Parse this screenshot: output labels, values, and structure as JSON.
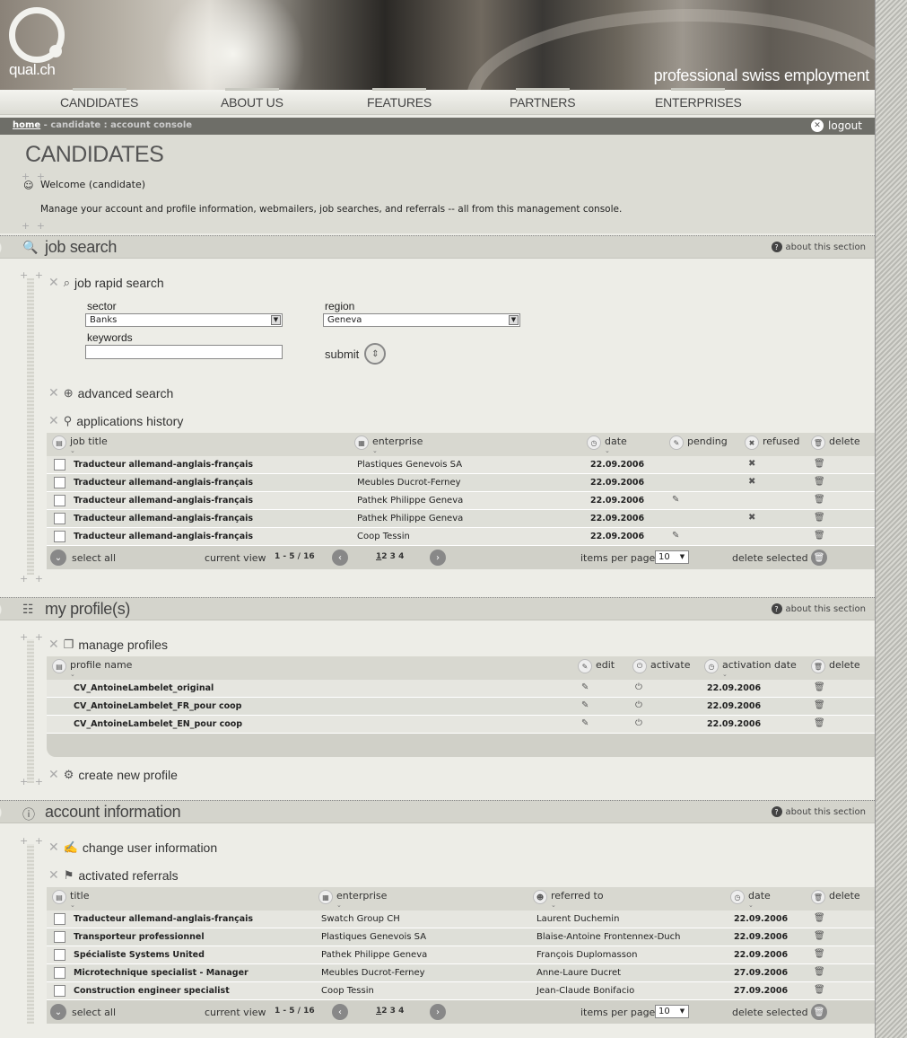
{
  "site": {
    "logo_text": "qual.ch",
    "tagline": "professional swiss employment"
  },
  "nav": [
    "CANDIDATES",
    "ABOUT US",
    "FEATURES",
    "PARTNERS",
    "ENTERPRISES"
  ],
  "breadcrumb": {
    "home": "home",
    "rest": " - candidate : account console",
    "logout": "logout"
  },
  "intro": {
    "title": "CANDIDATES",
    "welcome": "Welcome (candidate)",
    "description": "Manage your account and profile information, webmailers, job searches, and referrals -- all from this management console."
  },
  "about_label": "about this section",
  "job_search": {
    "title": "job search",
    "rapid_title": "job rapid search",
    "sector_label": "sector",
    "sector_value": "Banks",
    "region_label": "region",
    "region_value": "Geneva",
    "keywords_label": "keywords",
    "keywords_value": "",
    "submit_label": "submit",
    "advanced_title": "advanced search",
    "history_title": "applications history",
    "columns": [
      "job title",
      "enterprise",
      "date",
      "pending",
      "refused",
      "delete"
    ],
    "rows": [
      {
        "title": "Traducteur allemand-anglais-français",
        "enterprise": "Plastiques Genevois SA",
        "date": "22.09.2006",
        "pending": false,
        "refused": true
      },
      {
        "title": "Traducteur allemand-anglais-français",
        "enterprise": "Meubles Ducrot-Ferney",
        "date": "22.09.2006",
        "pending": false,
        "refused": true
      },
      {
        "title": "Traducteur allemand-anglais-français",
        "enterprise": "Pathek Philippe Geneva",
        "date": "22.09.2006",
        "pending": true,
        "refused": false
      },
      {
        "title": "Traducteur allemand-anglais-français",
        "enterprise": "Pathek Philippe Geneva",
        "date": "22.09.2006",
        "pending": false,
        "refused": true
      },
      {
        "title": "Traducteur allemand-anglais-français",
        "enterprise": "Coop Tessin",
        "date": "22.09.2006",
        "pending": true,
        "refused": false
      }
    ],
    "footer": {
      "select_all": "select all",
      "current_view": "current view",
      "range": "1 - 5 / 16",
      "pages": [
        "1",
        "2",
        "3",
        "4"
      ],
      "items_per_page": "items per page",
      "ipp_value": "10",
      "delete_selected": "delete selected"
    }
  },
  "profiles": {
    "title": "my profile(s)",
    "manage_title": "manage profiles",
    "columns": [
      "profile name",
      "edit",
      "activate",
      "activation date",
      "delete"
    ],
    "rows": [
      {
        "name": "CV_AntoineLambelet_original",
        "date": "22.09.2006"
      },
      {
        "name": "CV_AntoineLambelet_FR_pour coop",
        "date": "22.09.2006"
      },
      {
        "name": "CV_AntoineLambelet_EN_pour coop",
        "date": "22.09.2006"
      }
    ],
    "create_title": "create new profile"
  },
  "account": {
    "title": "account information",
    "change_title": "change user information",
    "referrals_title": "activated referrals",
    "columns": [
      "title",
      "enterprise",
      "referred to",
      "date",
      "delete"
    ],
    "rows": [
      {
        "title": "Traducteur allemand-anglais-français",
        "enterprise": "Swatch Group CH",
        "referred": "Laurent Duchemin",
        "date": "22.09.2006"
      },
      {
        "title": "Transporteur professionnel",
        "enterprise": "Plastiques Genevois SA",
        "referred": "Blaise-Antoine Frontennex-Duch",
        "date": "22.09.2006"
      },
      {
        "title": "Spécialiste Systems United",
        "enterprise": "Pathek Philippe Geneva",
        "referred": "François Duplomasson",
        "date": "22.09.2006"
      },
      {
        "title": "Microtechnique specialist - Manager",
        "enterprise": "Meubles Ducrot-Ferney",
        "referred": "Anne-Laure Ducret",
        "date": "27.09.2006"
      },
      {
        "title": "Construction engineer specialist",
        "enterprise": "Coop Tessin",
        "referred": "Jean-Claude Bonifacio",
        "date": "27.09.2006"
      }
    ],
    "footer": {
      "select_all": "select all",
      "current_view": "current view",
      "range": "1 - 5 / 16",
      "pages": [
        "1",
        "2",
        "3",
        "4"
      ],
      "items_per_page": "items per page",
      "ipp_value": "10",
      "delete_selected": "delete selected"
    }
  }
}
